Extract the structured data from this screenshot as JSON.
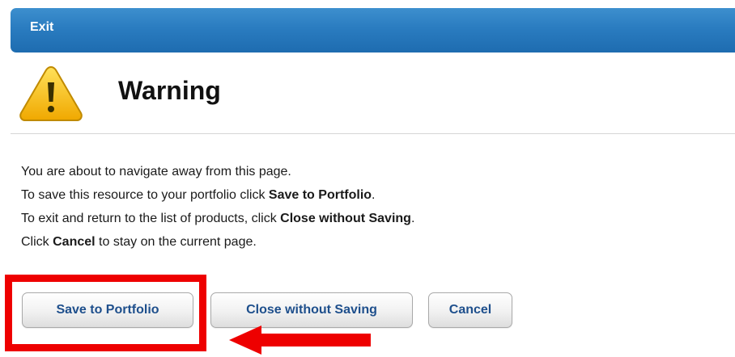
{
  "dialog": {
    "title": "Exit",
    "heading": "Warning",
    "icon": "warning-icon"
  },
  "message": {
    "line1": "You are about to navigate away from this page.",
    "line2_prefix": "To save this resource to your portfolio click ",
    "line2_bold": "Save to Portfolio",
    "line2_suffix": ".",
    "line3_prefix": "To exit and return to the list of products, click ",
    "line3_bold": "Close without Saving",
    "line3_suffix": ".",
    "line4_prefix": "Click ",
    "line4_bold": "Cancel",
    "line4_suffix": " to stay on the current page."
  },
  "buttons": {
    "save": "Save to Portfolio",
    "close": "Close without Saving",
    "cancel": "Cancel"
  },
  "colors": {
    "title_bar": "#2a7cc0",
    "button_text": "#1e4f8c",
    "highlight": "#ee0000",
    "warning_icon": "#f2b800"
  }
}
